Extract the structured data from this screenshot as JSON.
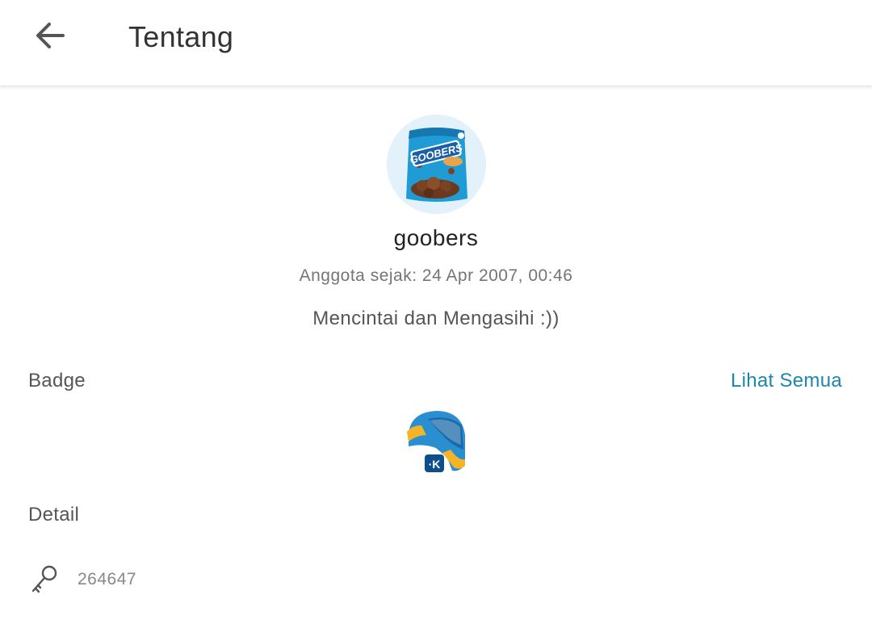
{
  "header": {
    "title": "Tentang",
    "back_icon": "arrow-left-icon"
  },
  "profile": {
    "avatar_icon": "goobers-avatar",
    "username": "goobers",
    "member_since": "Anggota sejak: 24 Apr 2007, 00:46",
    "bio": "Mencintai dan Mengasihi :))"
  },
  "badge_section": {
    "title": "Badge",
    "see_all_label": "Lihat Semua",
    "badges": [
      {
        "icon": "helmet-badge-icon"
      }
    ]
  },
  "detail_section": {
    "title": "Detail",
    "items": [
      {
        "icon": "key-icon",
        "value": "264647"
      }
    ]
  },
  "colors": {
    "accent": "#1d86b0",
    "text_primary": "#222222",
    "text_secondary": "#757575",
    "avatar_bg": "#e3f1fb"
  }
}
